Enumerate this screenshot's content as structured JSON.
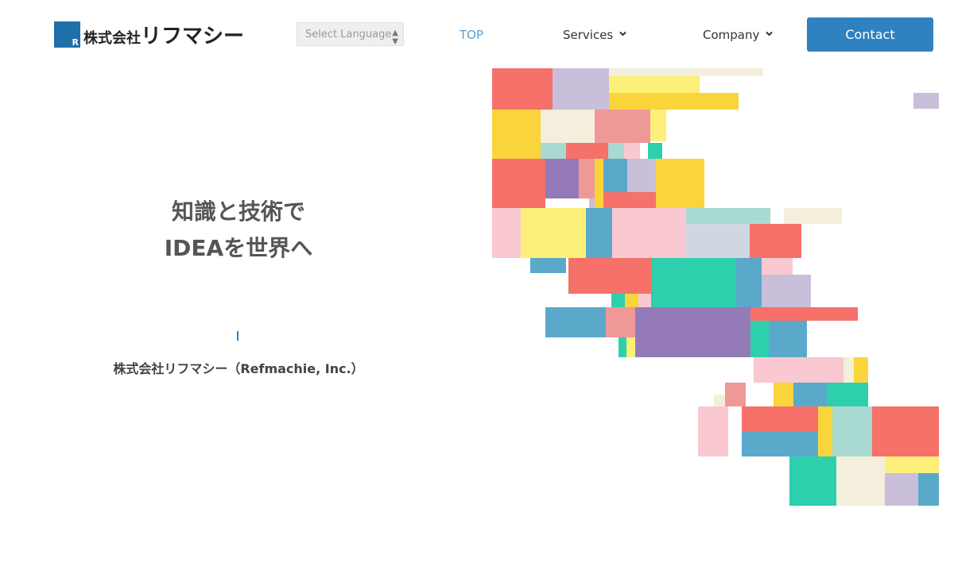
{
  "header": {
    "logo_small": "株式会社",
    "logo_big": "リフマシー",
    "logo_letter": "R",
    "language_placeholder": "Select Language",
    "nav": [
      {
        "label": "TOP"
      },
      {
        "label": "Services"
      },
      {
        "label": "Company"
      }
    ],
    "contact_label": "Contact"
  },
  "hero": {
    "line1": "知識と技術で",
    "line2": "IDEAを世界へ",
    "company": "株式会社リフマシー（Refmachie, Inc.）"
  },
  "colors": {
    "brand": "#2e82c0",
    "nav_active": "#5aa0d0",
    "tile_palette": [
      "#f5716a",
      "#c9bfd8",
      "#fcef7a",
      "#f9d43b",
      "#f3efdc",
      "#ef9898",
      "#a9dad2",
      "#2ecfad",
      "#5aa9cb",
      "#947bb7",
      "#f9c8d0",
      "#cfd8e2"
    ]
  }
}
